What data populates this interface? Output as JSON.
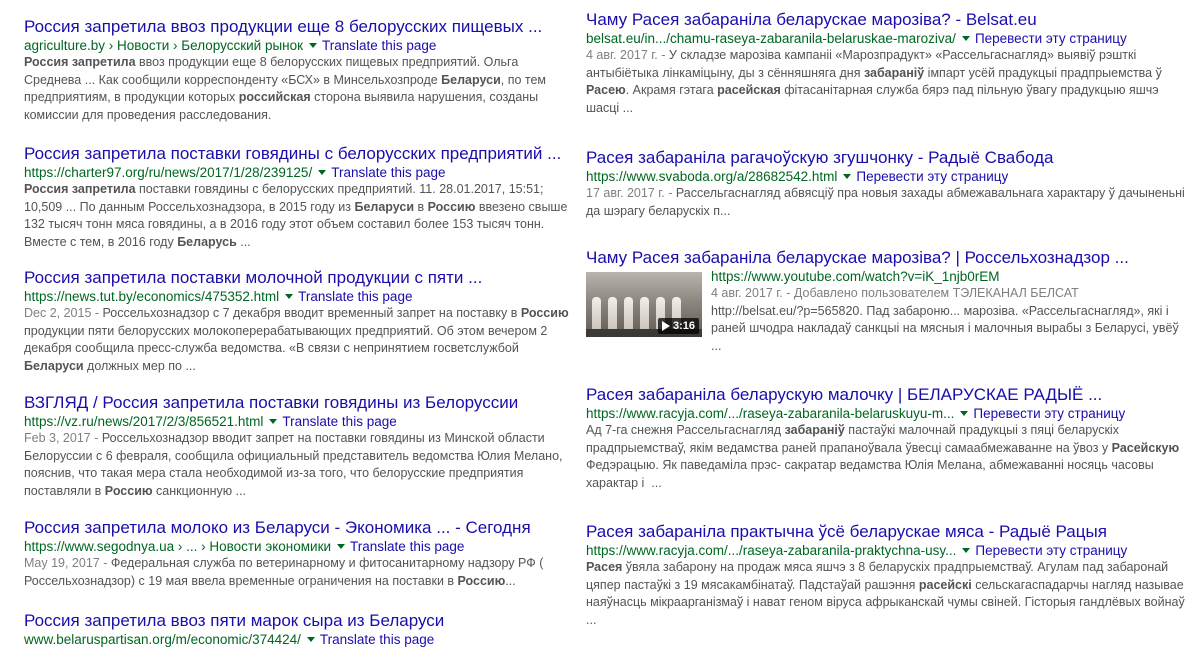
{
  "left_results": [
    {
      "title": "Россия запретила ввоз продукции еще 8 белорусских пищевых ...",
      "url": "agriculture.by › Новости › Белорусский рынок",
      "translate": "Translate this page",
      "date": "",
      "snippet": "<b>Россия запретила</b> ввоз продукции еще 8 белорусских пищевых предприятий. Ольга Среднева ... Как сообщили корреспонденту «БСХ» в Минсельхозпроде <b>Беларуси</b>, по тем предприятиям, в продукции которых <b>российская</b> сторона выявила нарушения, созданы комиссии для проведения расследования."
    },
    {
      "title": "Россия запретила поставки говядины с белорусских предприятий ...",
      "url": "https://charter97.org/ru/news/2017/1/28/239125/",
      "translate": "Translate this page",
      "date": "",
      "snippet": "<b>Россия запретила</b> поставки говядины с белорусских предприятий. 11. 28.01.2017, 15:51; 10,509 ... По данным Россельхознадзора, в 2015 году из <b>Беларуси</b> в <b>Россию</b> ввезено свыше 132 тысяч тонн мяса говядины, а в 2016 году этот объем составил более 153 тысяч тонн. Вместе с тем, в 2016 году <b>Беларусь</b> ..."
    },
    {
      "title": "Россия запретила поставки молочной продукции с пяти ...",
      "url": "https://news.tut.by/economics/475352.html",
      "translate": "Translate this page",
      "date": "Dec 2, 2015 - ",
      "snippet": "Россельхознадзор с 7 декабря вводит временный запрет на поставку в <b>Россию</b> продукции пяти белорусских молокоперерабатывающих предприятий. Об этом вечером 2 декабря сообщила пресс-служба ведомства. «В связи с непринятием госветслужбой <b>Беларуси</b> должных мер по ..."
    },
    {
      "title": "ВЗГЛЯД / Россия запретила поставки говядины из Белоруссии",
      "url": "https://vz.ru/news/2017/2/3/856521.html",
      "translate": "Translate this page",
      "date": "Feb 3, 2017 - ",
      "snippet": "Россельхознадзор вводит запрет на поставки говядины из Минской области Белоруссии с 6 февраля, сообщила официальный представитель ведомства Юлия Мелано, пояснив, что такая мера стала необходимой из-за того, что белорусские предприятия поставляли в <b>Россию</b> санкционную ..."
    },
    {
      "title": "Россия запретила молоко из Беларуси - Экономика ... - Сегодня",
      "url": "https://www.segodnya.ua › ... › Новости экономики",
      "translate": "Translate this page",
      "date": "May 19, 2017 - ",
      "snippet": "Федеральная служба по ветеринарному и фитосанитарному надзору РФ ( Россельхознадзор) с 19 мая ввела временные ограничения на поставки в <b>Россию</b>..."
    },
    {
      "title": "Россия запретила ввоз пяти марок сыра из Беларуси",
      "url": "www.belaruspartisan.org/m/economic/374424/",
      "translate": "Translate this page",
      "date": "",
      "snippet": ""
    }
  ],
  "right_results": [
    {
      "title": "Чаму Расея забараніла беларускае марозіва? - Belsat.eu",
      "url": "belsat.eu/in.../chamu-raseya-zabaranila-belaruskae-maroziva/",
      "translate": "Перевести эту страницу",
      "date": "4 авг. 2017 г. - ",
      "snippet": "У складзе марозіва кампаніі «Марозпрадукт» «Рассельгаснагляд» выявіў рэшткі антыбіётыка лінкаміцыну, ды з сённяшняга дня <b>забараніў</b> імпарт усёй прадукцыі прадпрыемства ў <b>Расею</b>. Акрамя гэтага <b>расейская</b> фітасанітарная служба бярэ пад пільную ўвагу прадукцыю яшчэ шасці ..."
    },
    {
      "title": "Расея забараніла рагачоўскую згушчонку - Радыё Свабода",
      "url": "https://www.svaboda.org/a/28682542.html",
      "translate": "Перевести эту страницу",
      "date": "17 авг. 2017 г. - ",
      "snippet": "Рассельгаснагляд абвясціў пра новыя захады абмежавальнага характару ў дачыненьні да шэрагу беларускіх п..."
    },
    {
      "title": "Чаму Расея забараніла беларускае марозіва? | Россельхознадзор ...",
      "url": "https://www.youtube.com/watch?v=iK_1njb0rEM",
      "translate": "",
      "date": "4 авг. 2017 г. - ",
      "meta": "Добавлено пользователем ТЭЛЕКАНАЛ БЕЛСАТ",
      "snippet": "http://belsat.eu/?p=565820. Пад забароню... марозіва. «Рассельгаснагляд», які і раней шчодра накладаў санкцыі на мясныя і малочныя вырабы з Беларусі, увёў ...",
      "duration": "3:16"
    },
    {
      "title": "Расея забараніла беларускую малочку | БЕЛАРУСКАЕ РАДЫЁ ...",
      "url": "https://www.racyja.com/.../raseya-zabaranila-belaruskuyu-m...",
      "translate": "Перевести эту страницу",
      "date": "",
      "snippet": "Ад 7-га снежня Рассельгаснагляд <b>забараніў</b> пастаўкі малочнай прадукцыі з пяці беларускіх прадпрыемстваў, якім ведамства раней прапаноўвала ўвесці самаабмежаванне на ўвоз у <b>Расейскую</b> Федэрацыю. Як паведаміла прэс- сакратар ведамства Юлія Мелана, абмежаванні носяць часовы характар і &nbsp;..."
    },
    {
      "title": "Расея забараніла практычна ўсё беларускае мяса - Радыё Рацыя",
      "url": "https://www.racyja.com/.../raseya-zabaranila-praktychna-usy...",
      "translate": "Перевести эту страницу",
      "date": "",
      "snippet": "<b>Расея</b> ўвяла забарону на продаж мяса яшчэ з 8 беларускіх прадпрыемстваў. Агулам пад забаронай цяпер пастаўкі з 19 мясакамбінатаў. Падстаўай рашэння <b>расейскі</b> сельскагаспадарчы нагляд называе наяўнасць мікраарганізмаў і нават геном віруса афрыканскай чумы свіней. Гісторыя гандлёвых войнаў ..."
    }
  ]
}
